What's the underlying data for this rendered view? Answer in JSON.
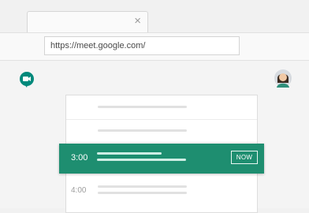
{
  "browser": {
    "tab": {
      "close_glyph": "×"
    },
    "address_bar": {
      "url": "https://meet.google.com/"
    }
  },
  "app": {
    "logo_icon": "meet-logo-icon",
    "avatar_icon": "user-avatar-icon"
  },
  "schedule": {
    "rows": [
      {
        "time": ""
      },
      {
        "time": ""
      },
      {
        "time": "3:00",
        "current": true,
        "badge": "NOW"
      },
      {
        "time": "4:00"
      }
    ]
  },
  "colors": {
    "accent": "#1e8e70",
    "background": "#f4f4f4"
  }
}
